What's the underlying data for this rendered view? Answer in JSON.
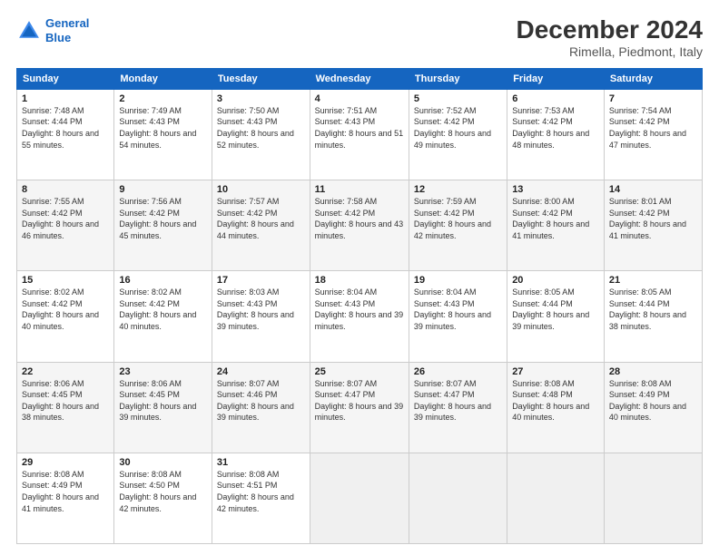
{
  "header": {
    "logo_line1": "General",
    "logo_line2": "Blue",
    "title": "December 2024",
    "subtitle": "Rimella, Piedmont, Italy"
  },
  "days_of_week": [
    "Sunday",
    "Monday",
    "Tuesday",
    "Wednesday",
    "Thursday",
    "Friday",
    "Saturday"
  ],
  "weeks": [
    [
      {
        "day": "1",
        "rise": "7:48 AM",
        "set": "4:44 PM",
        "daylight": "8 hours and 55 minutes."
      },
      {
        "day": "2",
        "rise": "7:49 AM",
        "set": "4:43 PM",
        "daylight": "8 hours and 54 minutes."
      },
      {
        "day": "3",
        "rise": "7:50 AM",
        "set": "4:43 PM",
        "daylight": "8 hours and 52 minutes."
      },
      {
        "day": "4",
        "rise": "7:51 AM",
        "set": "4:43 PM",
        "daylight": "8 hours and 51 minutes."
      },
      {
        "day": "5",
        "rise": "7:52 AM",
        "set": "4:42 PM",
        "daylight": "8 hours and 49 minutes."
      },
      {
        "day": "6",
        "rise": "7:53 AM",
        "set": "4:42 PM",
        "daylight": "8 hours and 48 minutes."
      },
      {
        "day": "7",
        "rise": "7:54 AM",
        "set": "4:42 PM",
        "daylight": "8 hours and 47 minutes."
      }
    ],
    [
      {
        "day": "8",
        "rise": "7:55 AM",
        "set": "4:42 PM",
        "daylight": "8 hours and 46 minutes."
      },
      {
        "day": "9",
        "rise": "7:56 AM",
        "set": "4:42 PM",
        "daylight": "8 hours and 45 minutes."
      },
      {
        "day": "10",
        "rise": "7:57 AM",
        "set": "4:42 PM",
        "daylight": "8 hours and 44 minutes."
      },
      {
        "day": "11",
        "rise": "7:58 AM",
        "set": "4:42 PM",
        "daylight": "8 hours and 43 minutes."
      },
      {
        "day": "12",
        "rise": "7:59 AM",
        "set": "4:42 PM",
        "daylight": "8 hours and 42 minutes."
      },
      {
        "day": "13",
        "rise": "8:00 AM",
        "set": "4:42 PM",
        "daylight": "8 hours and 41 minutes."
      },
      {
        "day": "14",
        "rise": "8:01 AM",
        "set": "4:42 PM",
        "daylight": "8 hours and 41 minutes."
      }
    ],
    [
      {
        "day": "15",
        "rise": "8:02 AM",
        "set": "4:42 PM",
        "daylight": "8 hours and 40 minutes."
      },
      {
        "day": "16",
        "rise": "8:02 AM",
        "set": "4:42 PM",
        "daylight": "8 hours and 40 minutes."
      },
      {
        "day": "17",
        "rise": "8:03 AM",
        "set": "4:43 PM",
        "daylight": "8 hours and 39 minutes."
      },
      {
        "day": "18",
        "rise": "8:04 AM",
        "set": "4:43 PM",
        "daylight": "8 hours and 39 minutes."
      },
      {
        "day": "19",
        "rise": "8:04 AM",
        "set": "4:43 PM",
        "daylight": "8 hours and 39 minutes."
      },
      {
        "day": "20",
        "rise": "8:05 AM",
        "set": "4:44 PM",
        "daylight": "8 hours and 39 minutes."
      },
      {
        "day": "21",
        "rise": "8:05 AM",
        "set": "4:44 PM",
        "daylight": "8 hours and 38 minutes."
      }
    ],
    [
      {
        "day": "22",
        "rise": "8:06 AM",
        "set": "4:45 PM",
        "daylight": "8 hours and 38 minutes."
      },
      {
        "day": "23",
        "rise": "8:06 AM",
        "set": "4:45 PM",
        "daylight": "8 hours and 39 minutes."
      },
      {
        "day": "24",
        "rise": "8:07 AM",
        "set": "4:46 PM",
        "daylight": "8 hours and 39 minutes."
      },
      {
        "day": "25",
        "rise": "8:07 AM",
        "set": "4:47 PM",
        "daylight": "8 hours and 39 minutes."
      },
      {
        "day": "26",
        "rise": "8:07 AM",
        "set": "4:47 PM",
        "daylight": "8 hours and 39 minutes."
      },
      {
        "day": "27",
        "rise": "8:08 AM",
        "set": "4:48 PM",
        "daylight": "8 hours and 40 minutes."
      },
      {
        "day": "28",
        "rise": "8:08 AM",
        "set": "4:49 PM",
        "daylight": "8 hours and 40 minutes."
      }
    ],
    [
      {
        "day": "29",
        "rise": "8:08 AM",
        "set": "4:49 PM",
        "daylight": "8 hours and 41 minutes."
      },
      {
        "day": "30",
        "rise": "8:08 AM",
        "set": "4:50 PM",
        "daylight": "8 hours and 42 minutes."
      },
      {
        "day": "31",
        "rise": "8:08 AM",
        "set": "4:51 PM",
        "daylight": "8 hours and 42 minutes."
      },
      null,
      null,
      null,
      null
    ]
  ]
}
